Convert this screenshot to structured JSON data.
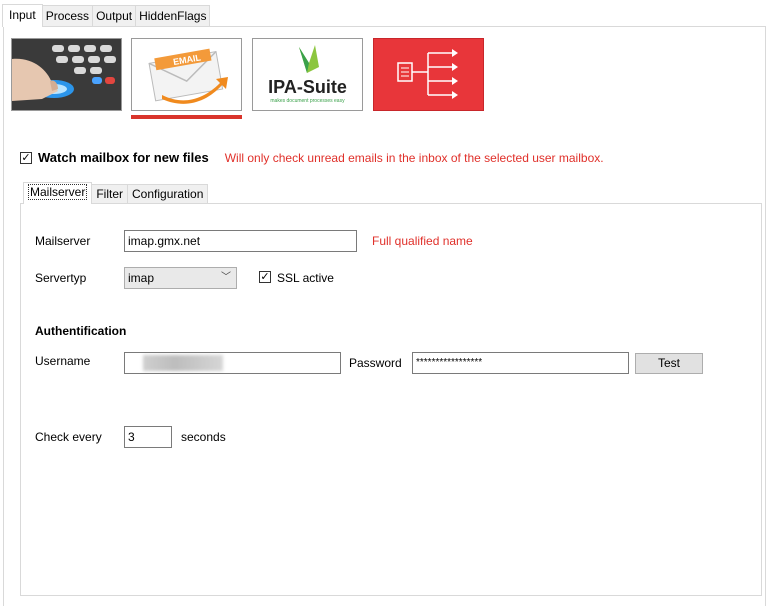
{
  "top_tabs": [
    "Input",
    "Process",
    "Output",
    "HiddenFlags"
  ],
  "tiles": {
    "email_label": "EMAIL",
    "ipa_brand": "IPA-Suite",
    "ipa_tagline": "makes document processes easy"
  },
  "watch": {
    "checked": true,
    "label": "Watch mailbox for new files",
    "note": "Will only check unread emails in the inbox of the selected user mailbox."
  },
  "inner_tabs": [
    "Mailserver",
    "Filter",
    "Configuration"
  ],
  "mailserver": {
    "label": "Mailserver",
    "value": "imap.gmx.net",
    "hint": "Full qualified name"
  },
  "servertyp": {
    "label": "Servertyp",
    "value": "imap",
    "ssl_label": "SSL active",
    "ssl_checked": true
  },
  "auth": {
    "heading": "Authentification",
    "username_label": "Username",
    "password_label": "Password",
    "password_value": "*****************",
    "test_button": "Test"
  },
  "check": {
    "label": "Check every",
    "value": "3",
    "unit": "seconds"
  },
  "colors": {
    "accent_red": "#e0302a",
    "flow_tile": "#e8363a"
  }
}
